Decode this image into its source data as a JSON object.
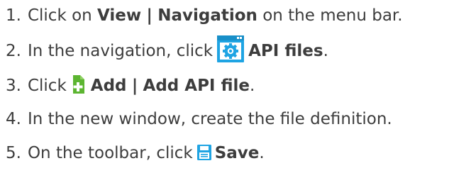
{
  "steps": [
    {
      "number": "1.",
      "text_before": "Click on",
      "bold1": "View",
      "sep": "|",
      "bold2": "Navigation",
      "text_after": "on the menu bar."
    },
    {
      "number": "2.",
      "text_before": "In the navigation, click",
      "icon": "api-files-icon",
      "bold1": "API files",
      "text_after": "."
    },
    {
      "number": "3.",
      "text_before": "Click",
      "icon": "add-file-icon",
      "bold1": "Add",
      "sep": "|",
      "bold2": "Add API file",
      "text_after": "."
    },
    {
      "number": "4.",
      "text_before": "In the new window, create the file definition."
    },
    {
      "number": "5.",
      "text_before": "On the toolbar, click",
      "icon": "save-icon",
      "bold1": "Save",
      "text_after": "."
    }
  ],
  "colors": {
    "text": "#3d3d3d",
    "icon_blue": "#1fa4e3",
    "icon_green": "#5cb531"
  }
}
